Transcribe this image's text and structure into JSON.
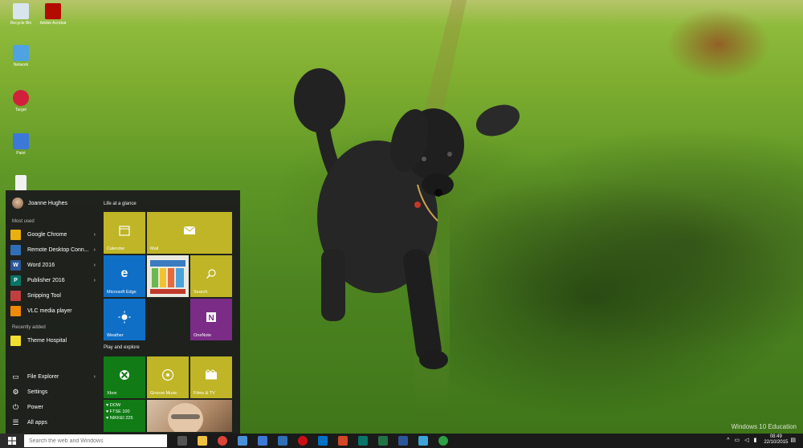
{
  "desktop": {
    "icons": [
      {
        "label": "Recycle Bin",
        "icon": "recycle-bin-icon",
        "color": "#d8e4ee"
      },
      {
        "label": "Adobe Acrobat",
        "icon": "acrobat-icon",
        "color": "#b30b00"
      },
      {
        "label": "Network",
        "icon": "network-icon",
        "color": "#4ea3e0"
      },
      {
        "label": "Target",
        "icon": "target-icon",
        "color": "#d1203c"
      },
      {
        "label": "Paint",
        "icon": "paint-icon",
        "color": "#3c78d8"
      }
    ],
    "watermark": "Windows 10 Education"
  },
  "start_menu": {
    "user_name": "Joanne Hughes",
    "most_used_label": "Most used",
    "most_used": [
      {
        "label": "Google Chrome",
        "icon": "chrome-icon",
        "color": "#e8b10d",
        "has_arrow": true
      },
      {
        "label": "Remote Desktop Conn...",
        "icon": "remote-desktop-icon",
        "color": "#2f6fb7",
        "has_arrow": true
      },
      {
        "label": "Word 2016",
        "icon": "word-icon",
        "color": "#2b579a",
        "has_arrow": true
      },
      {
        "label": "Publisher 2016",
        "icon": "publisher-icon",
        "color": "#077568",
        "has_arrow": true
      },
      {
        "label": "Snipping Tool",
        "icon": "snipping-tool-icon",
        "color": "#c04040",
        "has_arrow": false
      },
      {
        "label": "VLC media player",
        "icon": "vlc-icon",
        "color": "#f08a00",
        "has_arrow": false
      }
    ],
    "recently_added_label": "Recently added",
    "recently_added": [
      {
        "label": "Theme Hospital",
        "icon": "theme-hospital-icon",
        "color": "#f2e030"
      }
    ],
    "bottom": [
      {
        "label": "File Explorer",
        "icon": "folder-icon",
        "has_arrow": true
      },
      {
        "label": "Settings",
        "icon": "gear-icon",
        "has_arrow": false
      },
      {
        "label": "Power",
        "icon": "power-icon",
        "has_arrow": false
      },
      {
        "label": "All apps",
        "icon": "all-apps-icon",
        "has_arrow": false
      }
    ],
    "group1_label": "Life at a glance",
    "group2_label": "Play and explore",
    "tiles": {
      "calendar": "Calendar",
      "mail": "Mail",
      "edge": "Microsoft Edge",
      "search": "Search",
      "weather": "Weather",
      "onenote": "OneNote",
      "xbox": "Xbox",
      "groove": "Groove Music",
      "films": "Films & TV",
      "money_line1": "♥ DOW",
      "money_line2": "♥ FTSE 100",
      "money_line3": "♥ NIKKEI 225"
    },
    "colors": {
      "yellow": "#bfb526",
      "blue": "#0f6fc6",
      "purple": "#7b2c87",
      "green": "#117c16"
    }
  },
  "taskbar": {
    "search_placeholder": "Search the web and Windows",
    "apps": [
      {
        "icon": "task-view-icon",
        "color": "#555"
      },
      {
        "icon": "file-explorer-icon",
        "color": "#f0c040"
      },
      {
        "icon": "chrome-icon",
        "color": "#db4437"
      },
      {
        "icon": "store-icon",
        "color": "#4a90d9"
      },
      {
        "icon": "paint-icon",
        "color": "#3c78d8"
      },
      {
        "icon": "remote-desktop-icon",
        "color": "#2f6fb7"
      },
      {
        "icon": "opera-icon",
        "color": "#cc0f16"
      },
      {
        "icon": "outlook-icon",
        "color": "#0072c6"
      },
      {
        "icon": "powerpoint-icon",
        "color": "#d24726"
      },
      {
        "icon": "publisher-icon",
        "color": "#077568"
      },
      {
        "icon": "excel-icon",
        "color": "#217346"
      },
      {
        "icon": "word-icon",
        "color": "#2b579a"
      },
      {
        "icon": "photos-icon",
        "color": "#3ca4d8"
      },
      {
        "icon": "browser-icon",
        "color": "#2ea043"
      }
    ],
    "time": "08:49",
    "date": "22/10/2015"
  }
}
